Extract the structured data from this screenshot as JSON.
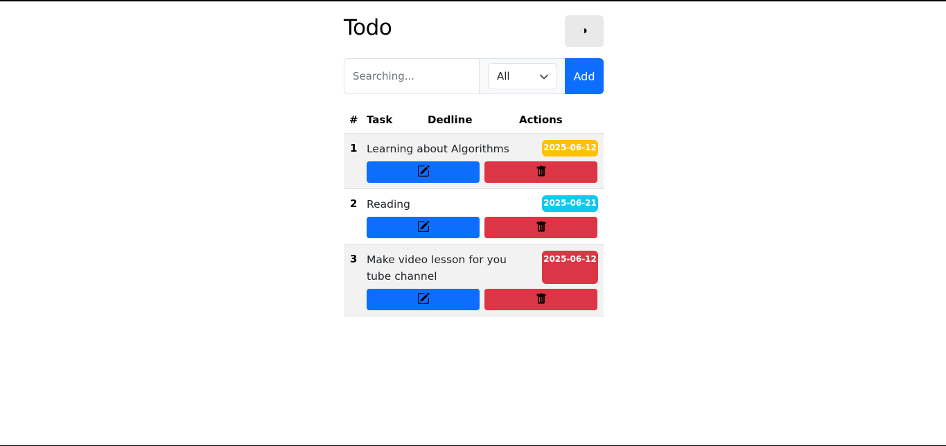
{
  "app": {
    "title": "Todo",
    "theme_icon": "◑"
  },
  "toolbar": {
    "search_placeholder": "Searching...",
    "filter_value": "All",
    "add_label": "Add"
  },
  "table": {
    "headers": {
      "num": "#",
      "task": "Task",
      "deadline": "Dedline",
      "actions": "Actions"
    },
    "rows": [
      {
        "num": "1",
        "task": "Learning about Algorithms",
        "deadline": "2025-06-12",
        "badge_color": "#ffc107"
      },
      {
        "num": "2",
        "task": "Reading",
        "deadline": "2025-06-21",
        "badge_color": "#0dcaf0"
      },
      {
        "num": "3",
        "task": "Make video lesson for you tube channel",
        "deadline": "2025-06-12",
        "badge_color": "#dc3545"
      }
    ]
  },
  "colors": {
    "primary": "#0d6efd",
    "danger": "#dc3545",
    "warning": "#ffc107",
    "info": "#0dcaf0"
  },
  "icons": {
    "edit": "edit-icon",
    "delete": "trash-icon",
    "theme": "contrast-icon",
    "dropdown": "chevron-down-icon"
  }
}
